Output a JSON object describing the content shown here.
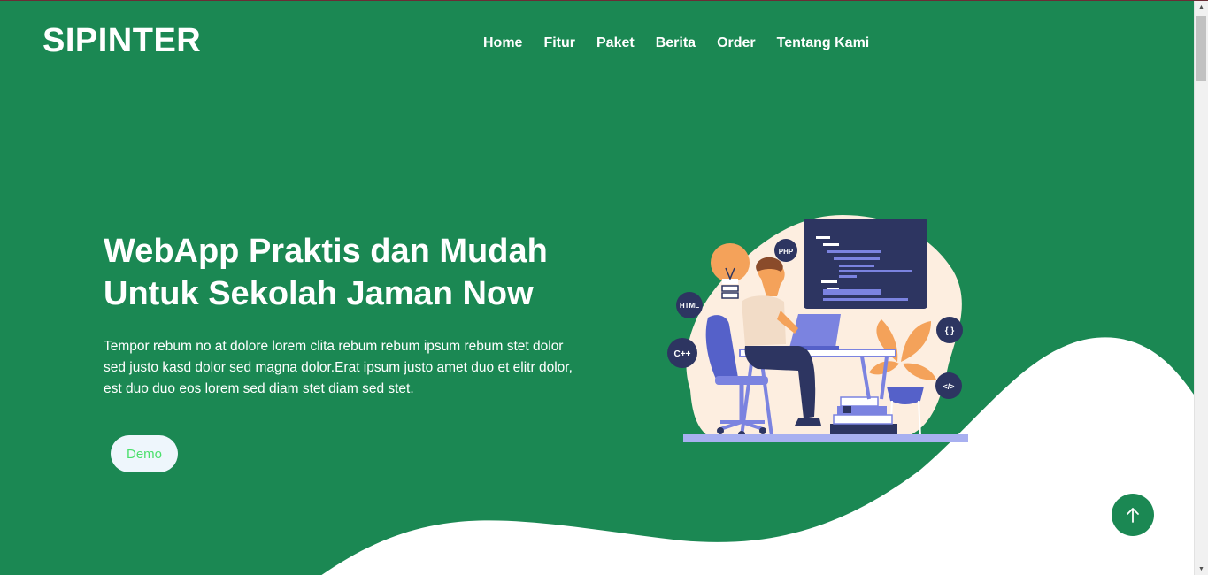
{
  "header": {
    "logo": "SIPINTER",
    "nav": [
      "Home",
      "Fitur",
      "Paket",
      "Berita",
      "Order",
      "Tentang Kami"
    ]
  },
  "hero": {
    "title_line1": "WebApp Praktis dan Mudah",
    "title_line2": "Untuk Sekolah Jaman Now",
    "text": "Tempor rebum no at dolore lorem clita rebum rebum ipsum rebum stet dolor sed justo kasd dolor sed magna dolor.Erat ipsum justo amet duo et elitr dolor, est duo duo eos lorem sed diam stet diam sed stet.",
    "demo_label": "Demo"
  },
  "illustration": {
    "badges": [
      "PHP",
      "HTML",
      "C++",
      "{ }",
      "</>"
    ]
  },
  "icons": {
    "back_to_top": "arrow-up-icon"
  },
  "colors": {
    "primary": "#1b8853",
    "white": "#ffffff",
    "demo_text": "#4be06c",
    "navy": "#2d3561",
    "periwinkle": "#7b83e0",
    "blob": "#fdeee0",
    "orange": "#f4a25a"
  }
}
